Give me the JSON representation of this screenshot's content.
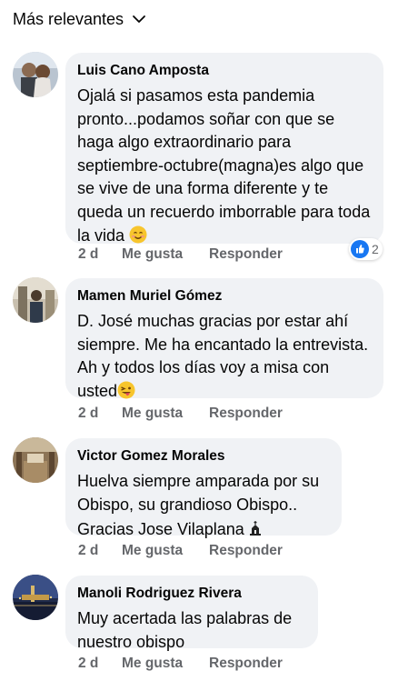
{
  "sort": {
    "label": "Más relevantes"
  },
  "comments": [
    {
      "author": "Luis Cano Amposta",
      "text": "Ojalá si pasamos esta pandemia pronto...podamos soñar con que se haga algo extraordinario para septiembre-octubre(magna)es algo que se vive de una forma diferente y te queda un recuerdo imborrable para toda la vida",
      "time": "2 d",
      "like": "Me gusta",
      "reply": "Responder",
      "reaction_count": "2"
    },
    {
      "author": "Mamen Muriel Gómez",
      "text": "D. José muchas gracias por estar ahí siempre. Me ha encantado la entrevista. Ah y todos los días voy a misa con usted",
      "time": "2 d",
      "like": "Me gusta",
      "reply": "Responder"
    },
    {
      "author": "Victor Gomez Morales",
      "text": "Huelva siempre amparada por su Obispo, su grandioso Obispo..",
      "text2": "Gracias Jose Vilaplana",
      "time": "2 d",
      "like": "Me gusta",
      "reply": "Responder"
    },
    {
      "author": "Manoli Rodriguez Rivera",
      "text": "Muy acertada las palabras de nuestro obispo",
      "time": "2 d",
      "like": "Me gusta",
      "reply": "Responder"
    }
  ],
  "colors": {
    "bubble": "#f0f2f5",
    "secondary_text": "#65676b",
    "like_blue": "#1877f2"
  },
  "icons": [
    "chevron-down-icon",
    "smiling-face-emoji",
    "winking-tongue-emoji",
    "church-icon",
    "like-reaction-icon"
  ]
}
